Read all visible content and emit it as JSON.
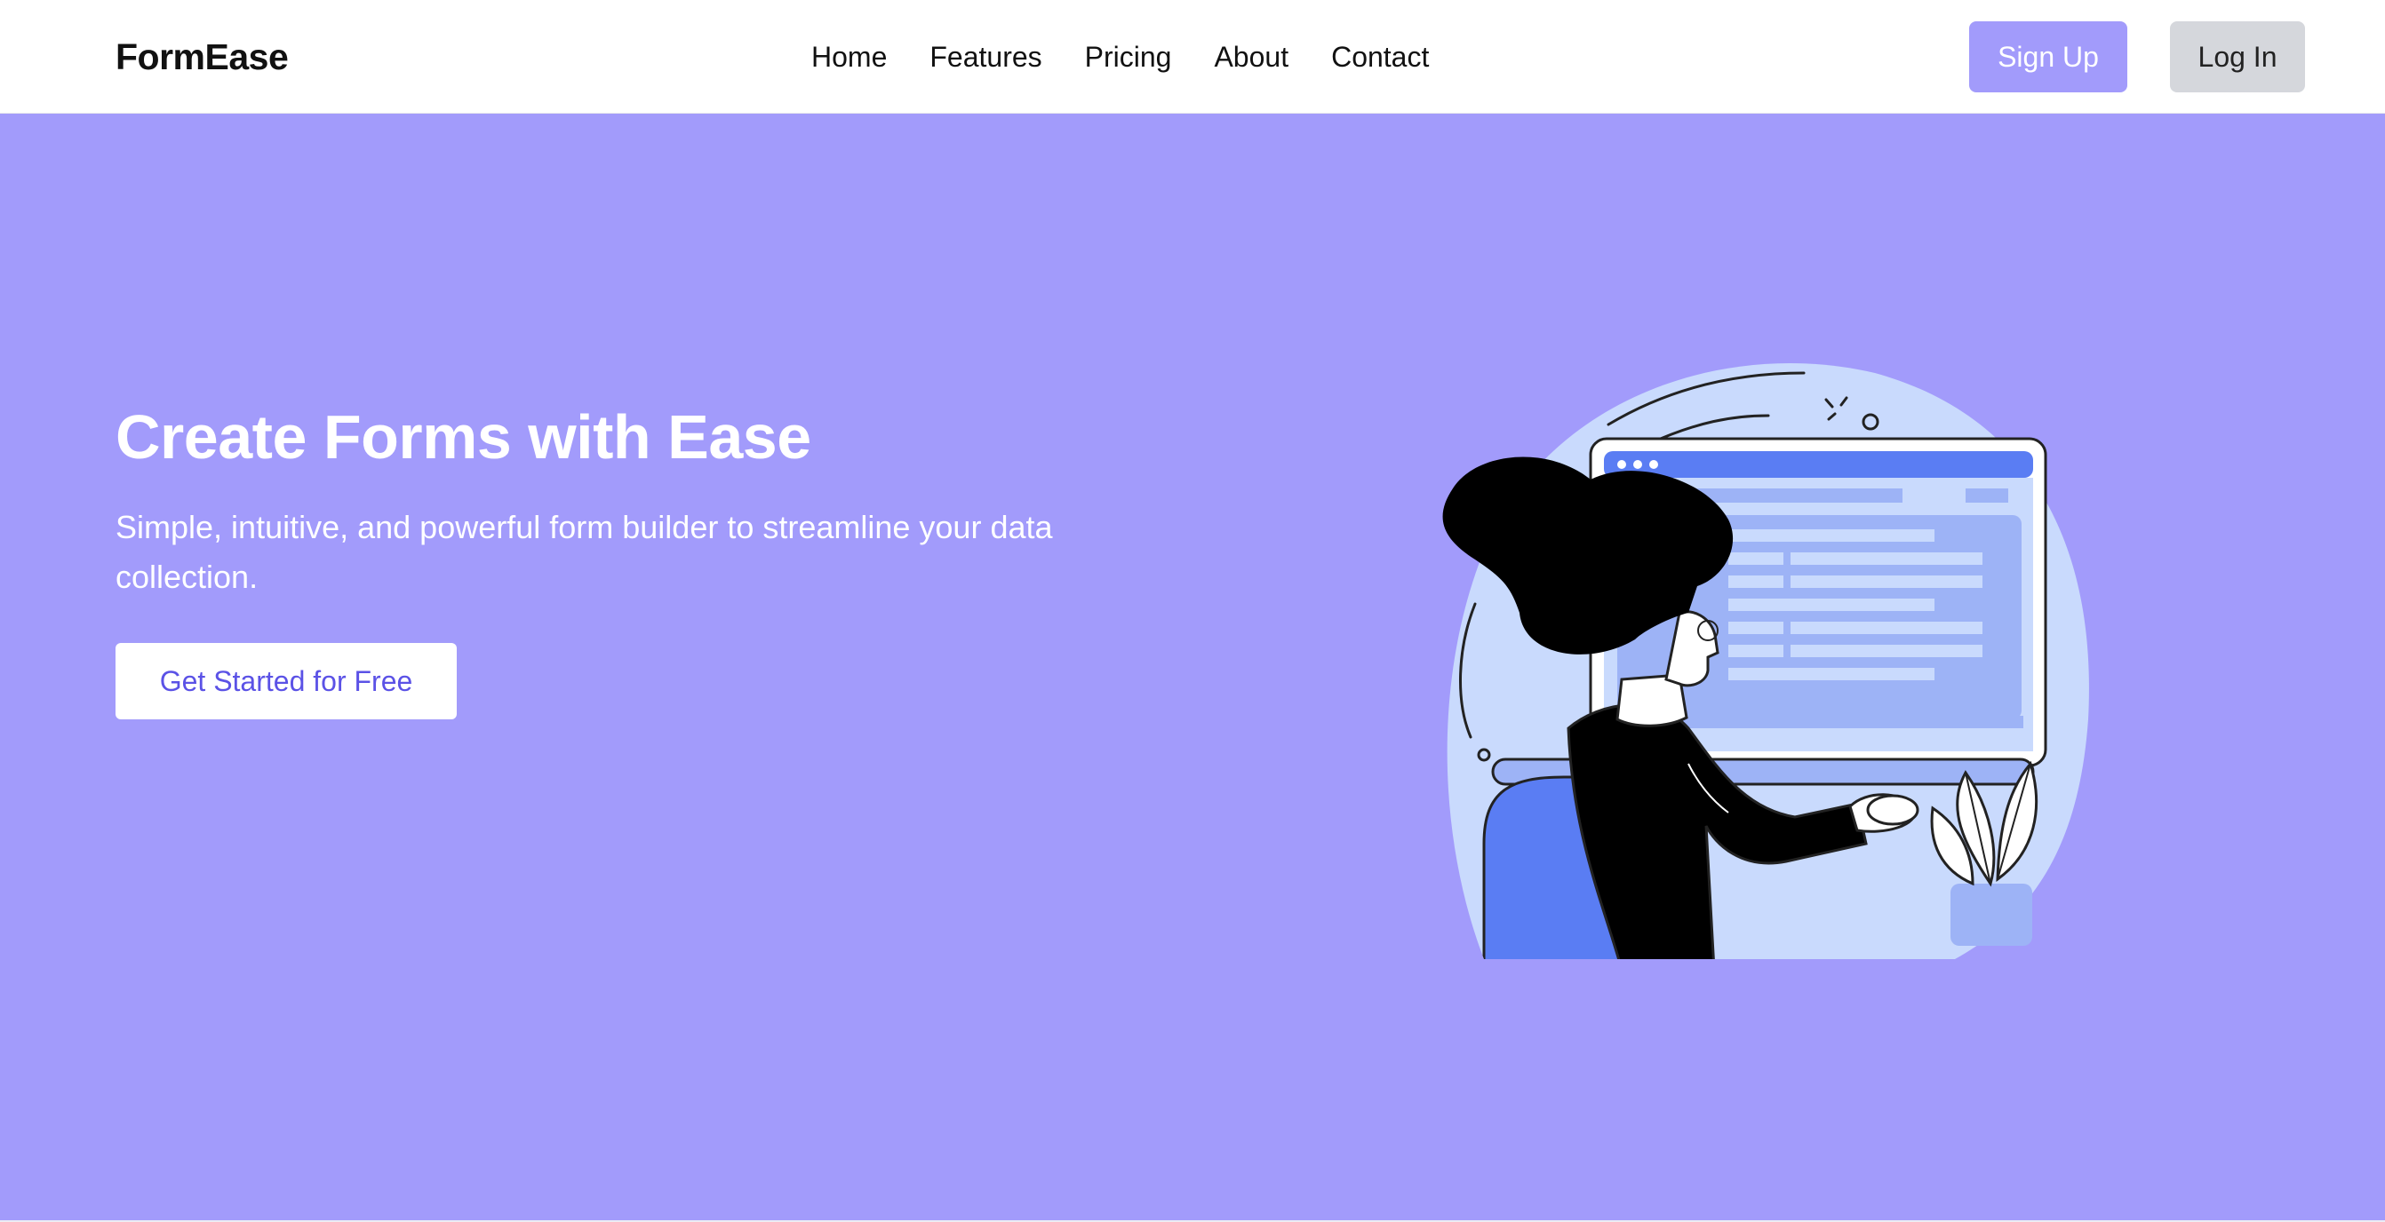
{
  "brand": {
    "name": "FormEase"
  },
  "nav": {
    "links": [
      "Home",
      "Features",
      "Pricing",
      "About",
      "Contact"
    ],
    "signup_label": "Sign Up",
    "login_label": "Log In"
  },
  "hero": {
    "title": "Create Forms with Ease",
    "subtitle": "Simple, intuitive, and powerful form builder to streamline your data collection.",
    "cta_label": "Get Started for Free"
  },
  "colors": {
    "hero_background": "#a29bfb",
    "signup_button": "#a29bfb",
    "login_button": "#d5d7dc",
    "cta_text": "#5b52e6",
    "illustration_blob": "#c9dafd",
    "illustration_accent": "#5a7df3"
  },
  "illustration": {
    "name": "woman-at-computer-illustration"
  }
}
